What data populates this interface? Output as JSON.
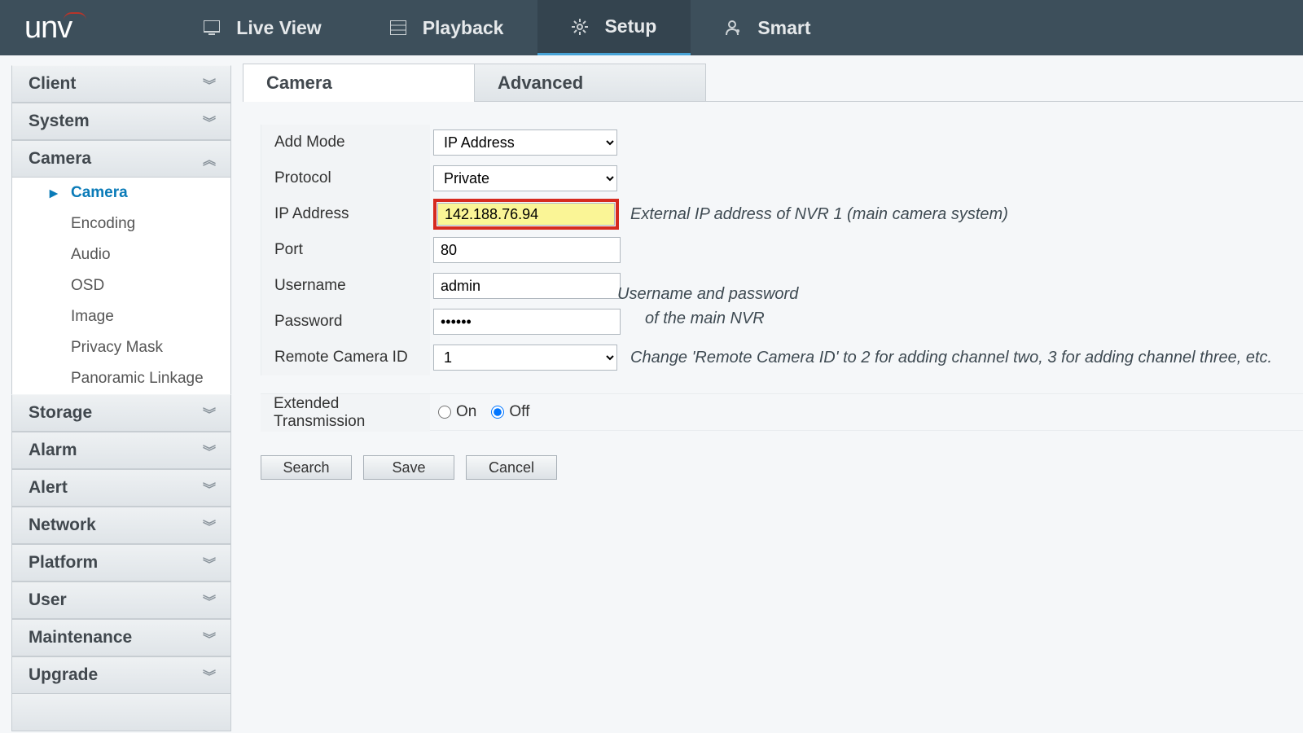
{
  "brand": "unv",
  "nav": {
    "live_view": "Live View",
    "playback": "Playback",
    "setup": "Setup",
    "smart": "Smart",
    "active": "setup"
  },
  "sidebar": {
    "groups": [
      {
        "label": "Client",
        "open": false
      },
      {
        "label": "System",
        "open": false
      },
      {
        "label": "Camera",
        "open": true,
        "items": [
          "Camera",
          "Encoding",
          "Audio",
          "OSD",
          "Image",
          "Privacy Mask",
          "Panoramic Linkage"
        ],
        "active_item": "Camera"
      },
      {
        "label": "Storage",
        "open": false
      },
      {
        "label": "Alarm",
        "open": false
      },
      {
        "label": "Alert",
        "open": false
      },
      {
        "label": "Network",
        "open": false
      },
      {
        "label": "Platform",
        "open": false
      },
      {
        "label": "User",
        "open": false
      },
      {
        "label": "Maintenance",
        "open": false
      },
      {
        "label": "Upgrade",
        "open": false
      }
    ]
  },
  "tabs": {
    "camera": "Camera",
    "advanced": "Advanced",
    "active": "camera"
  },
  "form": {
    "add_mode": {
      "label": "Add Mode",
      "value": "IP Address"
    },
    "protocol": {
      "label": "Protocol",
      "value": "Private"
    },
    "ip_address": {
      "label": "IP Address",
      "value": "142.188.76.94",
      "hint": "External IP address of NVR 1 (main camera system)"
    },
    "port": {
      "label": "Port",
      "value": "80"
    },
    "username": {
      "label": "Username",
      "value": "admin"
    },
    "password": {
      "label": "Password",
      "value": "••••••"
    },
    "cred_hint_l1": "Username and password",
    "cred_hint_l2": "of the main NVR",
    "remote_camera_id": {
      "label": "Remote Camera ID",
      "value": "1",
      "hint": "Change 'Remote Camera ID' to 2 for adding channel two, 3 for adding channel three, etc."
    },
    "ext_transmission": {
      "label": "Extended Transmission",
      "on": "On",
      "off": "Off",
      "value": "off"
    }
  },
  "buttons": {
    "search": "Search",
    "save": "Save",
    "cancel": "Cancel"
  },
  "colors": {
    "accent": "#48a3d6",
    "highlight_border": "#d62a1f",
    "highlight_bg": "#faf596"
  }
}
